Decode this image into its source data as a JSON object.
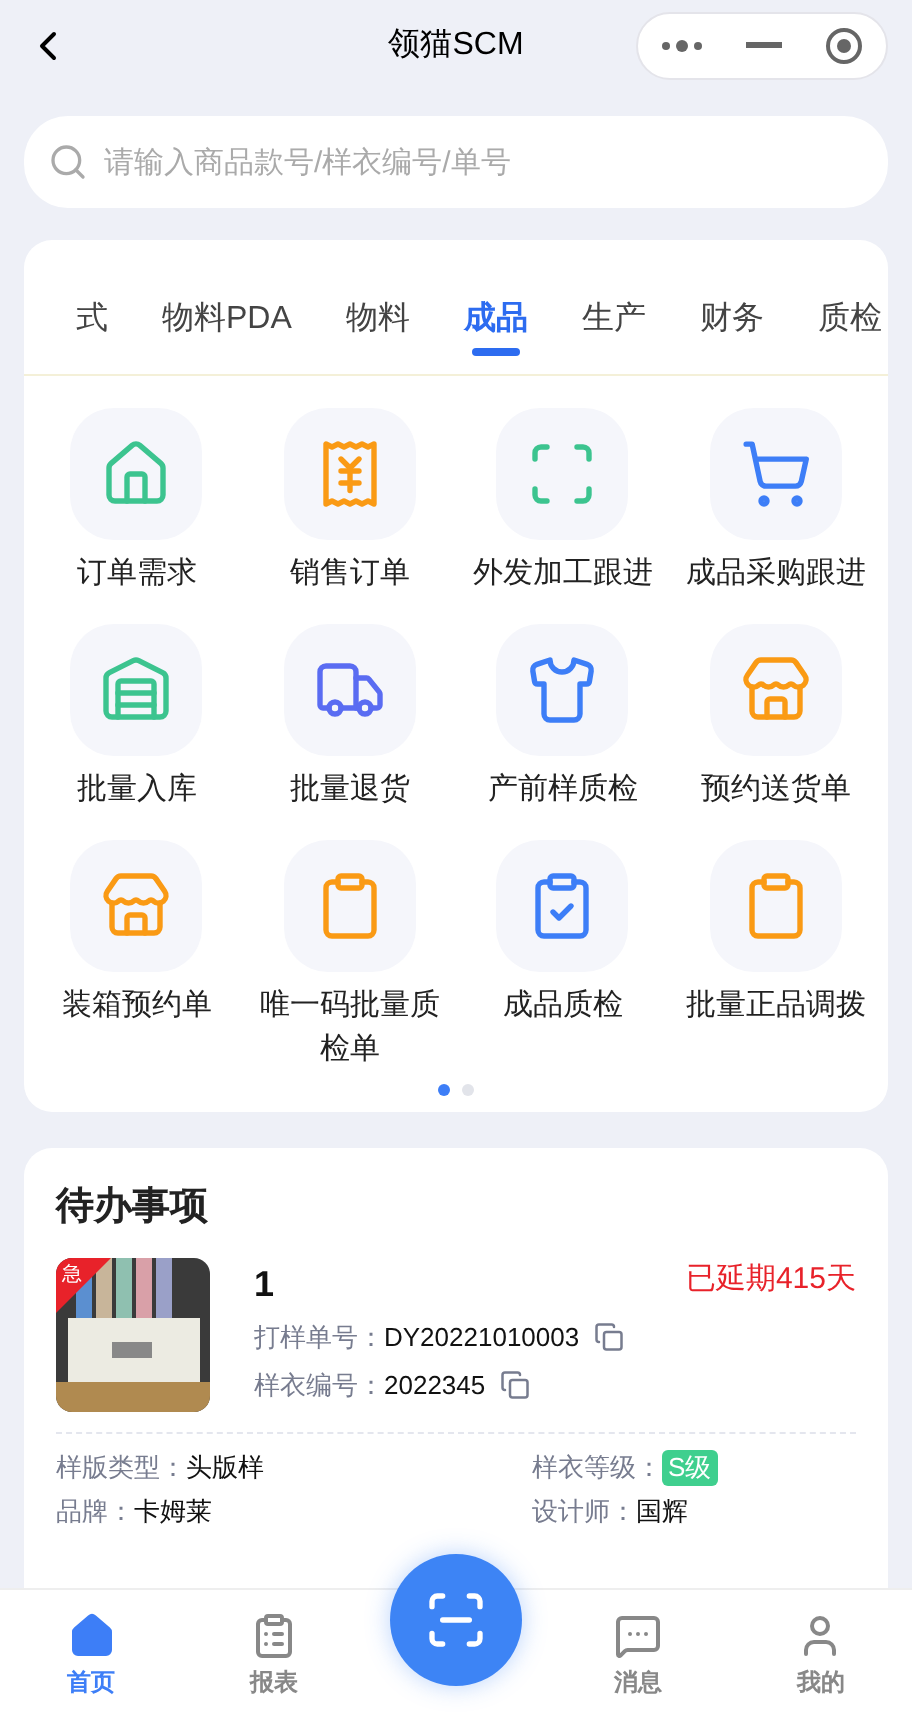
{
  "nav_bar": {
    "title": "领猫SCM"
  },
  "search": {
    "placeholder": "请输入商品款号/样衣编号/单号"
  },
  "category_tabs": [
    {
      "label": "式",
      "selected": false
    },
    {
      "label": "物料PDA",
      "selected": false
    },
    {
      "label": "物料",
      "selected": false
    },
    {
      "label": "成品",
      "selected": true
    },
    {
      "label": "生产",
      "selected": false
    },
    {
      "label": "财务",
      "selected": false
    },
    {
      "label": "质检",
      "selected": false
    }
  ],
  "shortcuts": [
    {
      "label": "订单需求",
      "kind": "house",
      "color": "#3cc48f"
    },
    {
      "label": "销售订单",
      "kind": "invoice",
      "color": "#fa9a14"
    },
    {
      "label": "外发加工跟进",
      "kind": "frame",
      "color": "#3cc48f"
    },
    {
      "label": "成品采购跟进",
      "kind": "cart",
      "color": "#3d7ef7"
    },
    {
      "label": "批量入库",
      "kind": "warehouse",
      "color": "#3cc48f"
    },
    {
      "label": "批量退货",
      "kind": "truck",
      "color": "#5a6cf2"
    },
    {
      "label": "产前样质检",
      "kind": "shirt",
      "color": "#3d7ef7"
    },
    {
      "label": "预约送货单",
      "kind": "store",
      "color": "#fa9a14"
    },
    {
      "label": "装箱预约单",
      "kind": "store",
      "color": "#fa9a14"
    },
    {
      "label": "唯一码批量质检单",
      "kind": "clipboard",
      "color": "#fa9a14"
    },
    {
      "label": "成品质检",
      "kind": "check",
      "color": "#3d7ef7"
    },
    {
      "label": "批量正品调拨",
      "kind": "clipboard",
      "color": "#fa9a14"
    }
  ],
  "pager": [
    {
      "selected": true
    },
    {
      "selected": false
    }
  ],
  "todo": {
    "title": "待办事项",
    "item": {
      "badge": "急",
      "name": "1",
      "overdue": "已延期415天",
      "codes": [
        {
          "label": "打样单号：",
          "value": "DY20221010003"
        },
        {
          "label": "样衣编号：",
          "value": "2022345"
        }
      ],
      "fields": [
        {
          "label": "样版类型：",
          "value": "头版样",
          "kind": "text"
        },
        {
          "label": "样衣等级：",
          "value": "S级",
          "kind": "tag"
        },
        {
          "label": "品牌：",
          "value": "卡姆莱",
          "kind": "text"
        },
        {
          "label": "设计师：",
          "value": "国辉",
          "kind": "text"
        }
      ]
    }
  },
  "tab_bar": {
    "items": [
      {
        "label": "首页",
        "kind": "home",
        "selected": true
      },
      {
        "label": "报表",
        "kind": "report",
        "selected": false
      },
      {
        "kind": "scan"
      },
      {
        "label": "消息",
        "kind": "message",
        "selected": false
      },
      {
        "label": "我的",
        "kind": "user",
        "selected": false
      }
    ]
  }
}
